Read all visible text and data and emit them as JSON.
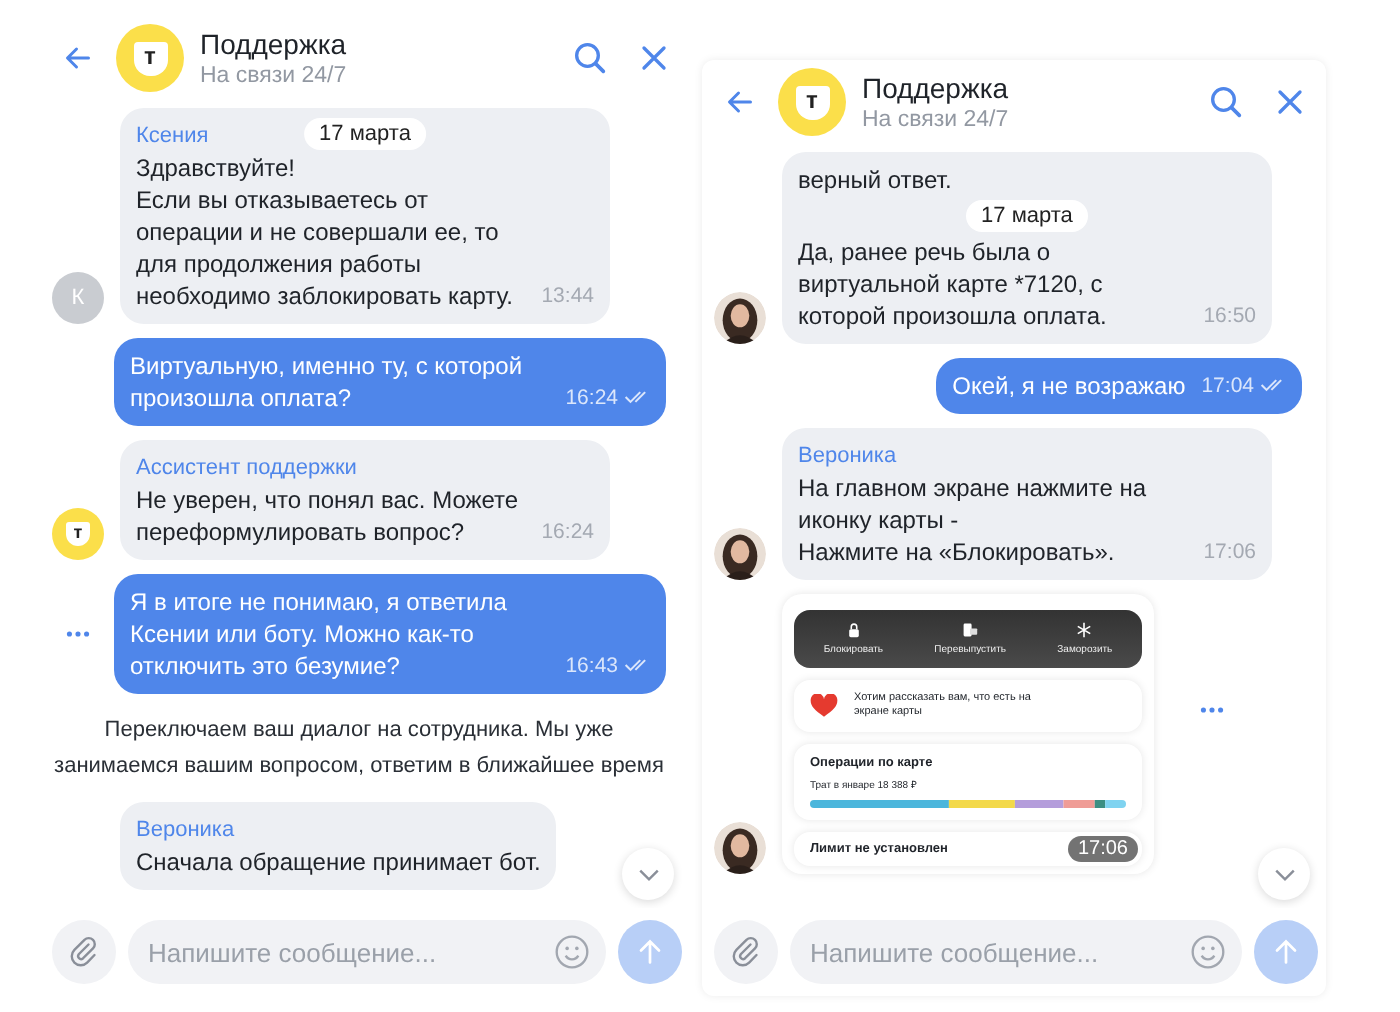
{
  "panels": [
    {
      "header": {
        "logo": "т",
        "title": "Поддержка",
        "status": "На связи 24/7"
      },
      "messages": [
        {
          "kind": "incoming",
          "avatar": {
            "kind": "letter",
            "text": "К"
          },
          "sender": "Ксения",
          "date": "17 марта",
          "text": "Здравствуйте!\nЕсли вы отказываетесь от операции и не совершали ее, то для продолжения работы необходимо заблокировать карту.",
          "time": "13:44"
        },
        {
          "kind": "outgoing",
          "text": "Виртуальную, именно ту, с которой произошла оплата?",
          "time": "16:24",
          "read": true,
          "typing": false
        },
        {
          "kind": "incoming",
          "avatar": {
            "kind": "logo",
            "text": "т"
          },
          "sender": "Ассистент поддержки",
          "text": "Не уверен, что понял вас. Можете переформулировать вопрос?",
          "time": "16:24"
        },
        {
          "kind": "outgoing",
          "text": "Я в итоге не понимаю, я ответила Ксении или боту. Можно как-то отключить это безумие?",
          "time": "16:43",
          "read": true,
          "typing": true
        },
        {
          "kind": "system",
          "text": "Переключаем ваш диалог на сотрудника. Мы уже занимаемся вашим вопросом, ответим в ближайшее время"
        },
        {
          "kind": "incoming",
          "sender": "Вероника",
          "text": "Сначала обращение принимает бот."
        }
      ],
      "composer": {
        "placeholder": "Напишите сообщение..."
      }
    },
    {
      "header": {
        "logo": "т",
        "title": "Поддержка",
        "status": "На связи 24/7"
      },
      "messages": [
        {
          "kind": "incoming",
          "avatar": {
            "kind": "picture"
          },
          "lead": "верный ответ.",
          "date": "17 марта",
          "text": "Да, ранее речь была о виртуальной карте *7120, с которой произошла оплата.",
          "time": "16:50"
        },
        {
          "kind": "outgoing",
          "text": "Окей, я не возражаю",
          "time": "17:04",
          "read": true,
          "typing": false
        },
        {
          "kind": "incoming",
          "avatar": {
            "kind": "picture"
          },
          "sender": "Вероника",
          "text": "На главном экране нажмите на иконку карты -\nНажмите на «Блокировать».",
          "time": "17:06"
        },
        {
          "avatar": {
            "kind": "picture"
          },
          "typing": true,
          "time": "17:06",
          "actions": [
            "Блокировать",
            "Перевыпустить",
            "Заморозить"
          ],
          "promo": "Хотим рассказать вам, что есть на экране карты",
          "operations_title": "Операции по карте",
          "operations_subtitle": "Трат в январе 18 388 ₽",
          "limit": "Лимит не установлен"
        }
      ],
      "composer": {
        "placeholder": "Напишите сообщение..."
      }
    }
  ]
}
